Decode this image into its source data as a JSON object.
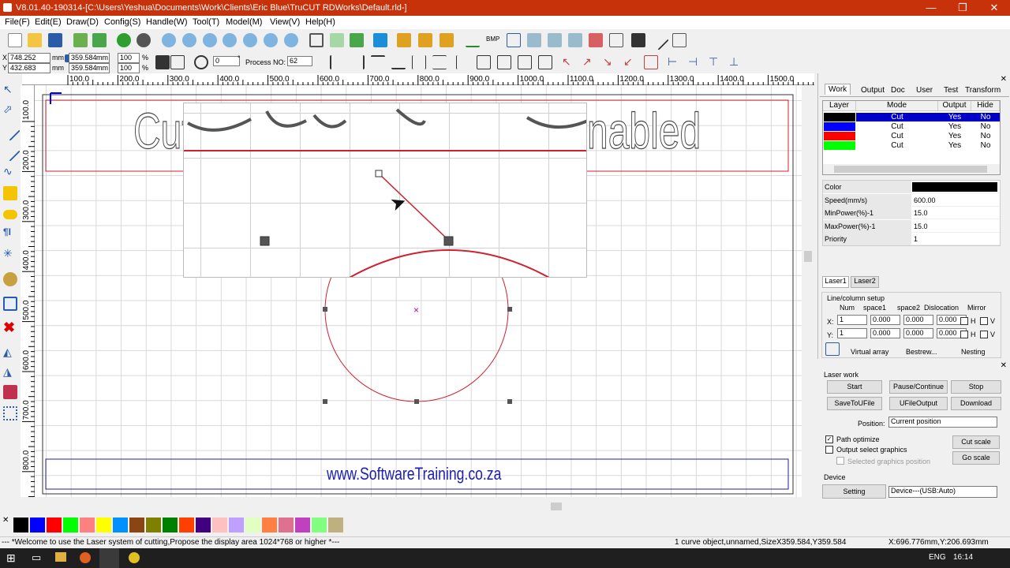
{
  "titlebar": {
    "title": "V8.01.40-190314-[C:\\Users\\Yeshua\\Documents\\Work\\Clients\\Eric Blue\\TruCUT RDWorks\\Default.rld-]",
    "min": "—",
    "max": "❐",
    "close": "✕"
  },
  "menu": [
    "File(F)",
    "Edit(E)",
    "Draw(D)",
    "Config(S)",
    "Handle(W)",
    "Tool(T)",
    "Model(M)",
    "View(V)",
    "Help(H)"
  ],
  "coords": {
    "x_label": "X",
    "y_label": "Y",
    "x_val": "748.252",
    "y_val": "432.683",
    "unit": "mm",
    "w_val": "359.584",
    "h_val": "359.584",
    "sx_val": "100",
    "sy_val": "100",
    "pct": "%",
    "rot_val": "0",
    "deg": "°",
    "process_label": "Process NO:",
    "process_val": "62"
  },
  "ruler": {
    "h_ticks": [
      "100.0",
      "200.0",
      "300.0",
      "400.0",
      "500.0",
      "600.0",
      "700.0",
      "800.0",
      "900.0",
      "1000.0",
      "1100.0",
      "1200.0",
      "1300.0",
      "1400.0",
      "1500.0"
    ],
    "v_ticks": [
      "100.0",
      "200.0",
      "300.0",
      "400.0",
      "500.0",
      "600.0",
      "700.0",
      "800.0"
    ]
  },
  "canvas": {
    "big_text_left": "Cut",
    "big_text_right": "nabled",
    "footer_text": "www.SoftwareTraining.co.za",
    "cursor": "➤"
  },
  "right": {
    "tabs": [
      "Work",
      "Output",
      "Doc",
      "User",
      "Test",
      "Transform"
    ],
    "layer_headers": [
      "Layer",
      "Mode",
      "Output",
      "Hide"
    ],
    "layers": [
      {
        "color": "#000000",
        "mode": "Cut",
        "output": "Yes",
        "hide": "No"
      },
      {
        "color": "#0000ff",
        "mode": "Cut",
        "output": "Yes",
        "hide": "No"
      },
      {
        "color": "#ff0000",
        "mode": "Cut",
        "output": "Yes",
        "hide": "No"
      },
      {
        "color": "#00ff00",
        "mode": "Cut",
        "output": "Yes",
        "hide": "No"
      }
    ],
    "props": [
      {
        "k": "Color",
        "v": ""
      },
      {
        "k": "Speed(mm/s)",
        "v": "600.00"
      },
      {
        "k": "MinPower(%)-1",
        "v": "15.0"
      },
      {
        "k": "MaxPower(%)-1",
        "v": "15.0"
      },
      {
        "k": "Priority",
        "v": "1"
      }
    ],
    "laser_tabs": [
      "Laser1",
      "Laser2"
    ],
    "linecol": {
      "title": "Line/column setup",
      "headers": [
        "Num",
        "space1",
        "space2",
        "Dislocation",
        "Mirror"
      ],
      "x_label": "X:",
      "y_label": "Y:",
      "x_vals": [
        "1",
        "0.000",
        "0.000",
        "0.000"
      ],
      "y_vals": [
        "1",
        "0.000",
        "0.000",
        "0.000"
      ],
      "h": "H",
      "v": "V"
    },
    "array_buttons": [
      "Virtual array",
      "Bestrew...",
      "Nesting"
    ]
  },
  "laserwork": {
    "title": "Laser work",
    "buttons": [
      "Start",
      "Pause/Continue",
      "Stop",
      "SaveToUFile",
      "UFileOutput",
      "Download"
    ],
    "position_label": "Position:",
    "position_val": "Current position",
    "path_optimize": "Path optimize",
    "output_select": "Output select graphics",
    "selected_pos": "Selected graphics position",
    "cut_scale": "Cut scale",
    "go_scale": "Go scale",
    "device_title": "Device",
    "setting": "Setting",
    "device_val": "Device---(USB:Auto)"
  },
  "palette": [
    "#000000",
    "#0000ff",
    "#ff0000",
    "#00ff00",
    "#ff8080",
    "#ffff00",
    "#0090ff",
    "#8b4513",
    "#808000",
    "#008000",
    "#ff4000",
    "#400080",
    "#ffc0c0",
    "#c0a0ff",
    "#e0ffc0",
    "#ff8040",
    "#e07090",
    "#c040c0",
    "#80ff80",
    "#c0b080"
  ],
  "status": {
    "welcome": "--- *Welcome to use the Laser system of cutting,Propose the display area 1024*768 or higher *---",
    "object": "1 curve object,unnamed,SizeX359.584,Y359.584",
    "cursor_pos": "X:696.776mm,Y:206.693mm"
  },
  "taskbar": {
    "time": "16:14",
    "lang": "ENG"
  },
  "colors": {
    "title": "#c8320a",
    "selected": "#0000c8",
    "guide": "#d02030"
  }
}
